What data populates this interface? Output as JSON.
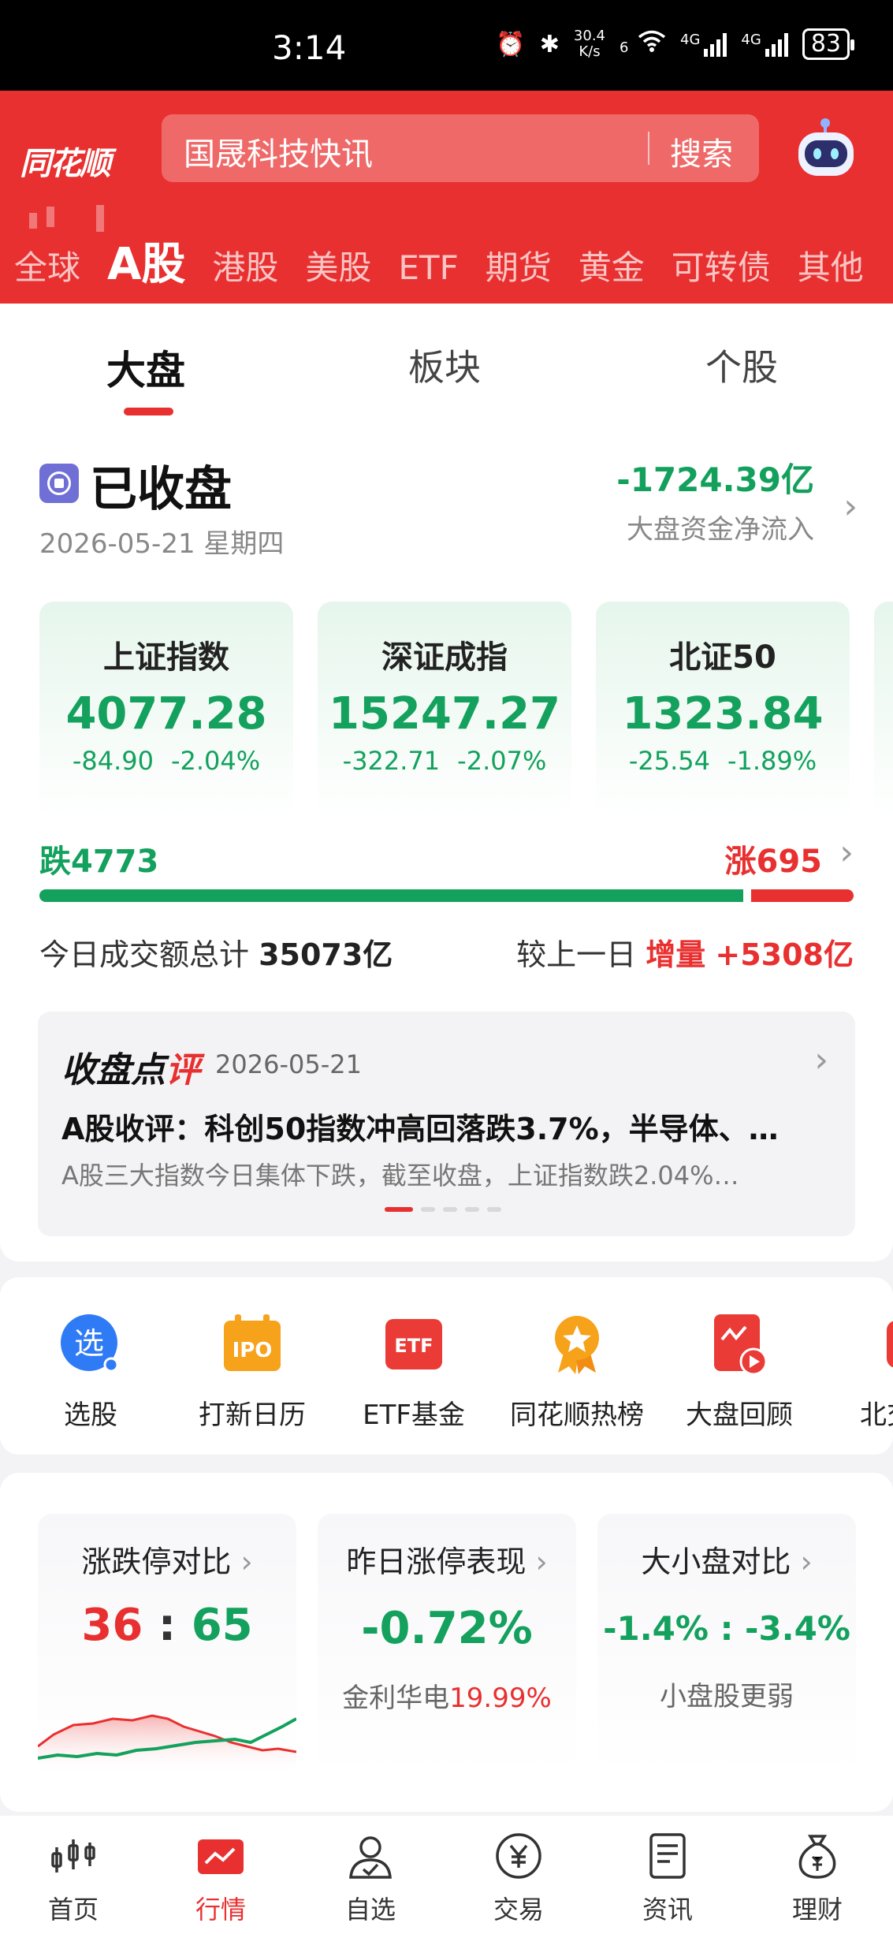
{
  "status_bar": {
    "time": "3:14",
    "net_speed_value": "30.4",
    "net_speed_unit": "K/s",
    "wifi_label": "6",
    "sim1_label": "4G",
    "sim2_label": "4G",
    "battery": "83"
  },
  "header": {
    "logo_text": "同花顺",
    "search_placeholder": "国晟科技快讯",
    "search_button": "搜索",
    "market_tabs": [
      "全球",
      "A股",
      "港股",
      "美股",
      "ETF",
      "期货",
      "黄金",
      "可转债",
      "其他"
    ],
    "active_tab": "A股"
  },
  "sub_tabs": [
    "大盘",
    "板块",
    "个股"
  ],
  "market_status": {
    "label": "已收盘",
    "date": "2026-05-21 星期四",
    "net_flow_value": "-1724.39亿",
    "net_flow_label": "大盘资金净流入"
  },
  "indices": [
    {
      "name": "上证指数",
      "price": "4077.28",
      "change": "-84.90",
      "pct": "-2.04%"
    },
    {
      "name": "深证成指",
      "price": "15247.27",
      "change": "-322.71",
      "pct": "-2.07%"
    },
    {
      "name": "北证50",
      "price": "1323.84",
      "change": "-25.54",
      "pct": "-1.89%"
    }
  ],
  "breadth": {
    "down_label": "跌4773",
    "up_label": "涨695",
    "down_count": 4773,
    "up_count": 695
  },
  "turnover": {
    "label": "今日成交额总计",
    "value": "35073亿",
    "compare_label": "较上一日",
    "delta_label": "增量",
    "delta_value": "+5308亿"
  },
  "review": {
    "title_a": "收盘点",
    "title_b": "评",
    "date": "2026-05-21",
    "headline": "A股收评：科创50指数冲高回落跌3.7%，半导体、…",
    "summary": "A股三大指数今日集体下跌，截至收盘，上证指数跌2.04%…"
  },
  "shortcuts": [
    {
      "label": "选股",
      "icon_text": "选"
    },
    {
      "label": "打新日历",
      "icon_text": "IPO"
    },
    {
      "label": "ETF基金",
      "icon_text": "ETF"
    },
    {
      "label": "同花顺热榜",
      "icon_text": ""
    },
    {
      "label": "大盘回顾",
      "icon_text": ""
    },
    {
      "label": "北交",
      "icon_text": ""
    }
  ],
  "stats": {
    "limit": {
      "title": "涨跌停对比",
      "up": "36",
      "sep": ":",
      "down": "65"
    },
    "yesterday": {
      "title": "昨日涨停表现",
      "value": "-0.72%",
      "stock": "金利华电",
      "stock_pct": "19.99%"
    },
    "size": {
      "title": "大小盘对比",
      "value": "-1.4% : -3.4%",
      "note": "小盘股更弱"
    }
  },
  "bottom_nav": [
    "首页",
    "行情",
    "自选",
    "交易",
    "资讯",
    "理财"
  ],
  "colors": {
    "brand_red": "#e93030",
    "down_green": "#13a15d"
  }
}
